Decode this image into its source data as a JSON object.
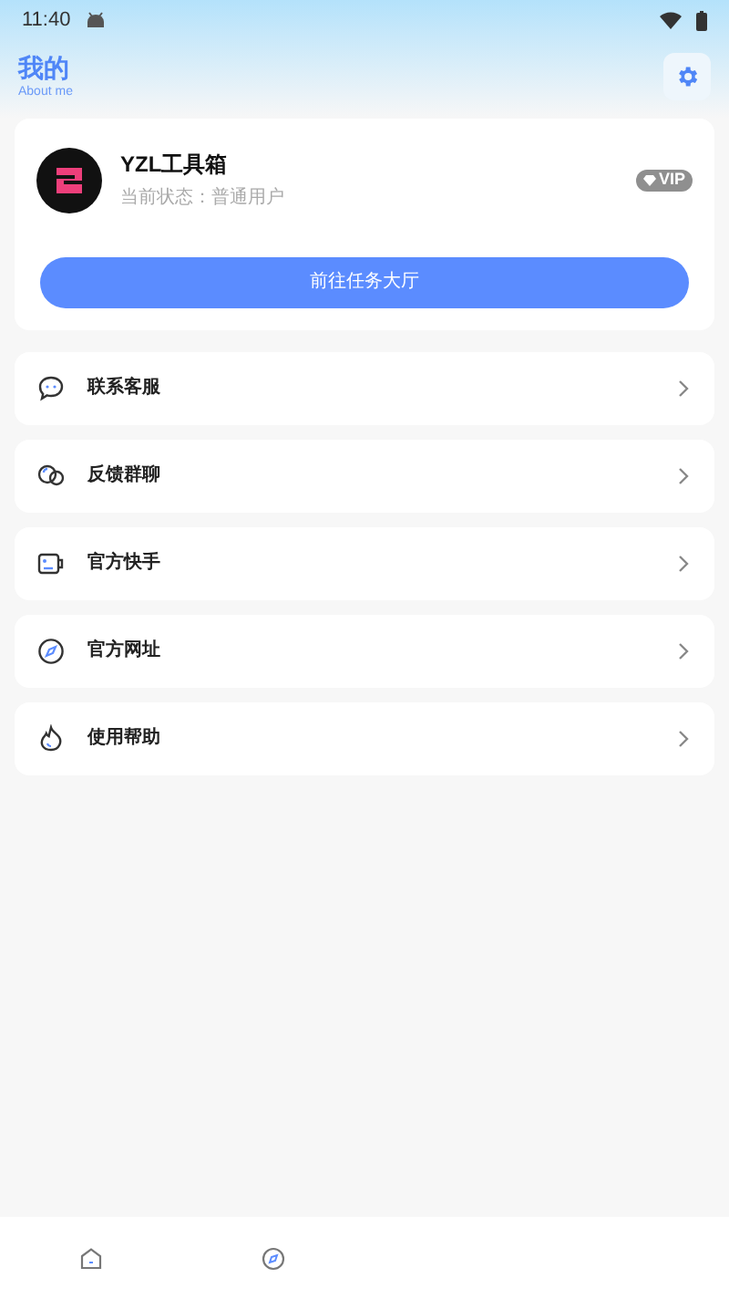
{
  "status_bar": {
    "time": "11:40"
  },
  "header": {
    "title": "我的",
    "subtitle": "About me"
  },
  "profile": {
    "name": "YZL工具箱",
    "status": "当前状态：普通用户",
    "badge": "VIP",
    "button": "前往任务大厅"
  },
  "menu": [
    {
      "kind": "chat",
      "label": "联系客服"
    },
    {
      "kind": "group",
      "label": "反馈群聊"
    },
    {
      "kind": "card",
      "label": "官方快手"
    },
    {
      "kind": "compass",
      "label": "官方网址"
    },
    {
      "kind": "help",
      "label": "使用帮助"
    }
  ],
  "bottom_nav": [
    {
      "kind": "home",
      "selected": false
    },
    {
      "kind": "compass",
      "selected": false
    }
  ]
}
